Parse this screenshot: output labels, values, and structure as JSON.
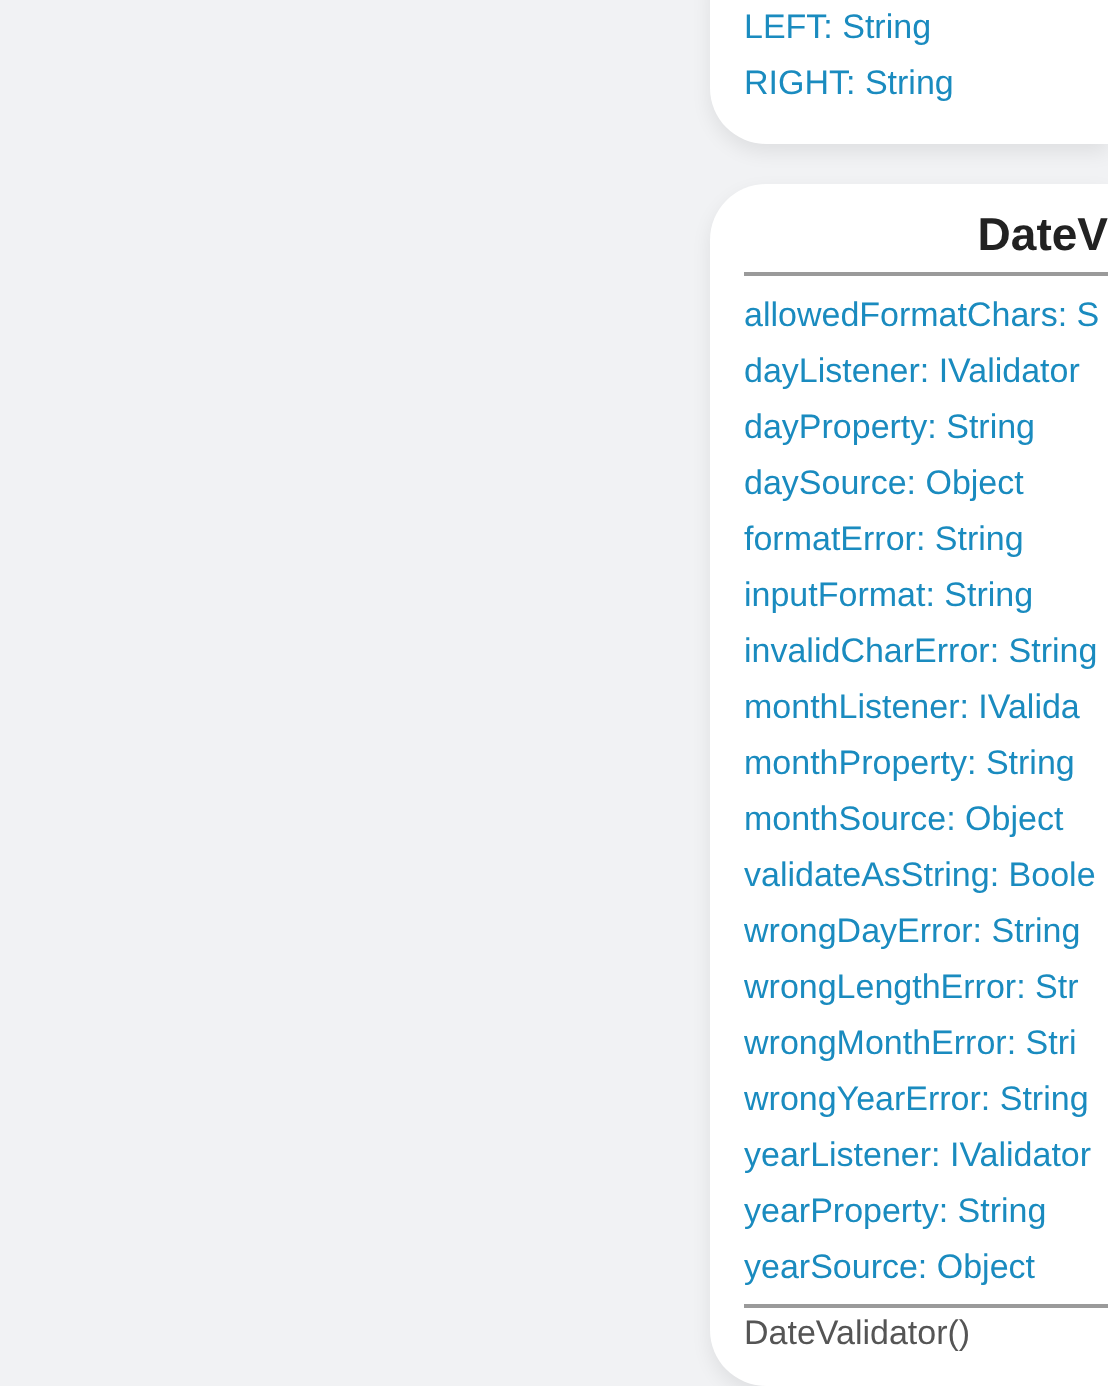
{
  "top_card": {
    "attributes": [
      "LEFT: String",
      "RIGHT: String"
    ]
  },
  "class_card": {
    "title": "DateV",
    "attributes": [
      "allowedFormatChars: S",
      "dayListener: IValidator",
      "dayProperty: String",
      "daySource: Object",
      "formatError: String",
      "inputFormat: String",
      "invalidCharError: String",
      "monthListener: IValida",
      "monthProperty: String",
      "monthSource: Object",
      "validateAsString: Boole",
      "wrongDayError: String",
      "wrongLengthError: Str",
      "wrongMonthError: Stri",
      "wrongYearError: String",
      "yearListener: IValidator",
      "yearProperty: String",
      "yearSource: Object"
    ],
    "methods": [
      "DateValidator()"
    ]
  }
}
